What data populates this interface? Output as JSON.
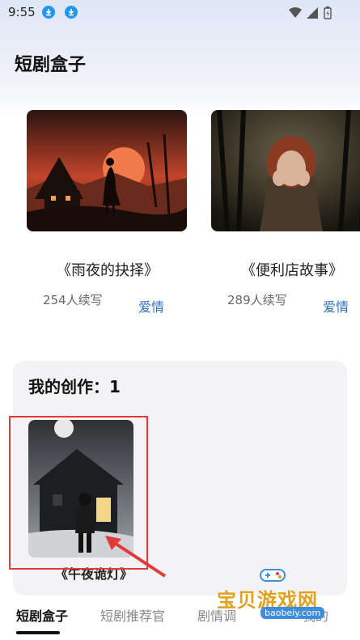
{
  "status_bar": {
    "time": "9:55",
    "icons": [
      "download-icon",
      "download-icon",
      "wifi-icon",
      "signal-icon",
      "battery-icon"
    ]
  },
  "header": {
    "title": "短剧盒子"
  },
  "featured": [
    {
      "title": "《雨夜的抉择》",
      "count": "254人续写",
      "genre": "爱情"
    },
    {
      "title": "《便利店故事》",
      "count": "289人续写",
      "genre": "爱情"
    }
  ],
  "my_works": {
    "title": "我的创作：1",
    "items": [
      {
        "title": "《午夜诡灯》"
      }
    ]
  },
  "bottom_nav": {
    "tabs": [
      "短剧盒子",
      "短剧推荐官",
      "剧情调",
      "我的"
    ],
    "active": 0
  },
  "watermark": {
    "text": "宝贝游戏网",
    "url": "baobeiy.com"
  },
  "colors": {
    "accent_link": "#2f6fb8",
    "highlight": "#e13a3a",
    "download_badge": "#2196f3"
  }
}
